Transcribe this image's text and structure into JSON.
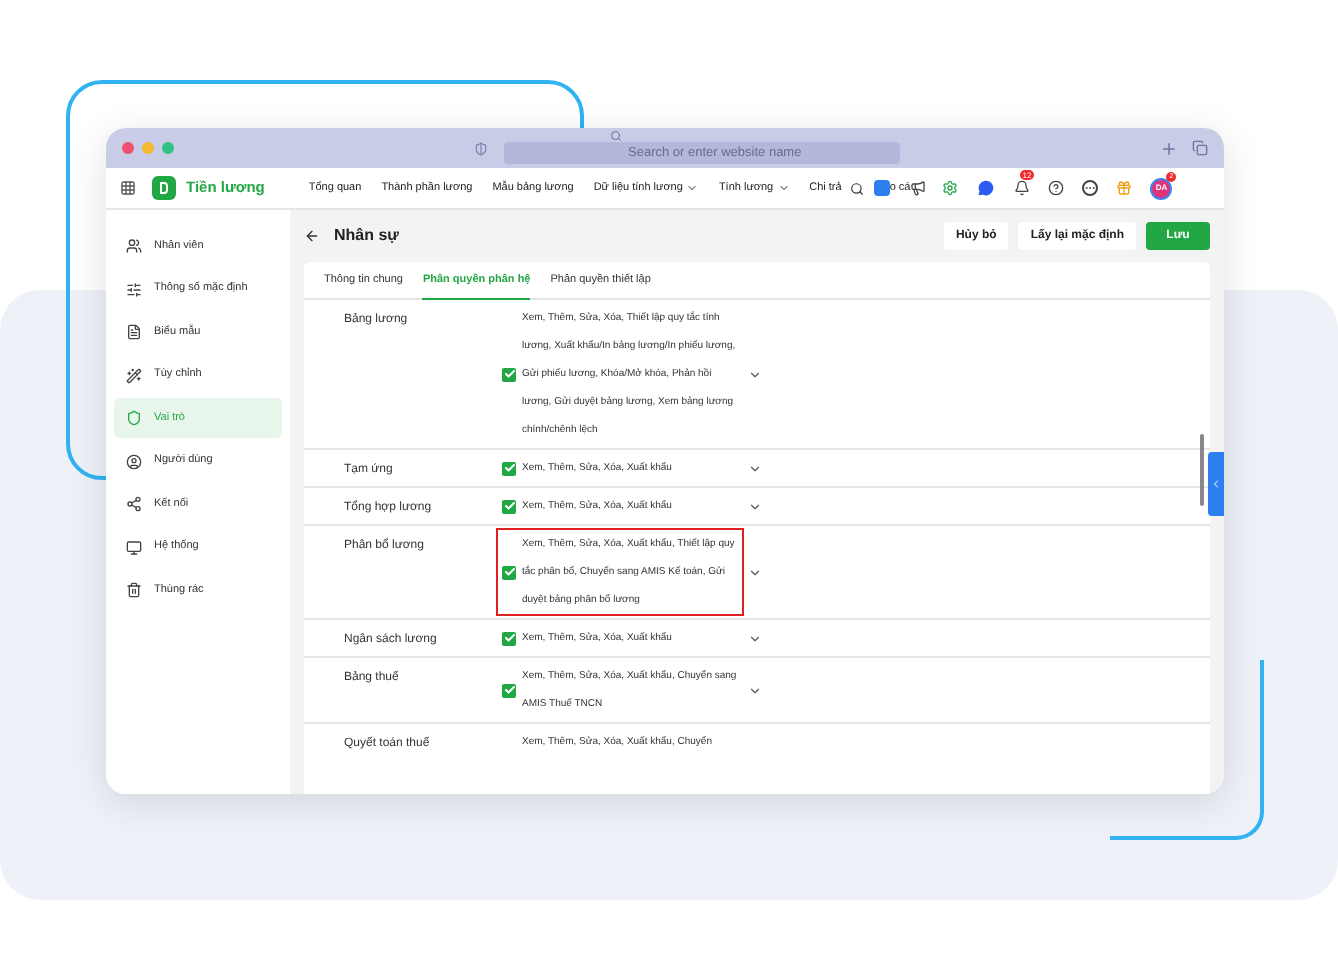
{
  "browser": {
    "address_placeholder": "Search or enter website name"
  },
  "app": {
    "name": "Tiền lương",
    "nav": [
      {
        "label": "Tổng quan",
        "dropdown": false
      },
      {
        "label": "Thành phần lương",
        "dropdown": false
      },
      {
        "label": "Mẫu bảng lương",
        "dropdown": false
      },
      {
        "label": "Dữ liệu tính lương",
        "dropdown": true
      },
      {
        "label": "Tính lương",
        "dropdown": true
      },
      {
        "label": "Chi trả",
        "dropdown": false
      }
    ],
    "report_fragment": "o cá",
    "notification_count": "12",
    "avatar_initials": "DA",
    "avatar_badge": "2"
  },
  "sidebar": {
    "items": [
      {
        "label": "Nhân viên",
        "selected": false
      },
      {
        "label": "Thông số mặc định",
        "selected": false
      },
      {
        "label": "Biểu mẫu",
        "selected": false
      },
      {
        "label": "Tùy chỉnh",
        "selected": false
      },
      {
        "label": "Vai trò",
        "selected": true
      },
      {
        "label": "Người dùng",
        "selected": false
      },
      {
        "label": "Kết nối",
        "selected": false
      },
      {
        "label": "Hệ thống",
        "selected": false
      },
      {
        "label": "Thùng rác",
        "selected": false
      }
    ]
  },
  "page": {
    "title": "Nhân sự",
    "buttons": [
      {
        "label": "Hủy bỏ",
        "kind": "secondary"
      },
      {
        "label": "Lấy lại mặc định",
        "kind": "secondary"
      },
      {
        "label": "Lưu",
        "kind": "primary"
      }
    ]
  },
  "tabs": [
    {
      "label": "Thông tin chung",
      "selected": false
    },
    {
      "label": "Phân quyền phân hệ",
      "selected": true
    },
    {
      "label": "Phân quyền thiết lập",
      "selected": false
    }
  ],
  "permissions": [
    {
      "module": "Bảng lương",
      "permissions": "Xem, Thêm, Sửa, Xóa, Thiết lập quy tắc tính lương, Xuất khẩu/In bảng lương/In phiếu lương, Gửi phiếu lương, Khóa/Mở khóa, Phản hồi lương, Gửi duyệt bảng lương, Xem bảng lương chính/chênh lệch",
      "checked": true,
      "highlighted": false
    },
    {
      "module": "Tạm ứng",
      "permissions": "Xem, Thêm, Sửa, Xóa, Xuất khẩu",
      "checked": true,
      "highlighted": false
    },
    {
      "module": "Tổng hợp lương",
      "permissions": "Xem, Thêm, Sửa, Xóa, Xuất khẩu",
      "checked": true,
      "highlighted": false
    },
    {
      "module": "Phân bổ lương",
      "permissions": "Xem, Thêm, Sửa, Xóa, Xuất khẩu, Thiết lập quy tắc phân bổ, Chuyển sang AMIS Kế toán, Gửi duyệt bảng phân bổ lương",
      "checked": true,
      "highlighted": true
    },
    {
      "module": "Ngân sách lương",
      "permissions": "Xem, Thêm, Sửa, Xóa, Xuất khẩu",
      "checked": true,
      "highlighted": false
    },
    {
      "module": "Bảng thuế",
      "permissions": "Xem, Thêm, Sửa, Xóa, Xuất khẩu, Chuyển sang AMIS Thuế TNCN",
      "checked": true,
      "highlighted": false
    },
    {
      "module": "Quyết toán thuế",
      "permissions": "Xem, Thêm, Sửa, Xóa, Xuất khẩu, Chuyển",
      "highlighted": false
    }
  ]
}
